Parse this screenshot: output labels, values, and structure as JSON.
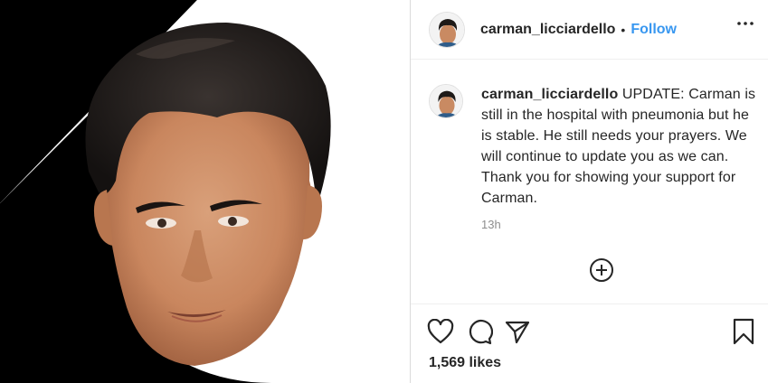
{
  "post": {
    "username": "carman_licciardello",
    "separator": "•",
    "follow_label": "Follow",
    "more_icon": "more-options-icon",
    "caption": {
      "username": "carman_licciardello",
      "text": "UPDATE: Carman is still in the hospital with pneumonia but he is stable. He still needs your prayers. We will continue to update you as we can. Thank you for showing your support for Carman.",
      "time": "13h"
    },
    "load_more_icon": "plus-circle-icon",
    "actions": {
      "like_icon": "heart-icon",
      "comment_icon": "comment-icon",
      "share_icon": "paper-plane-icon",
      "save_icon": "bookmark-icon"
    },
    "likes": "1,569 likes"
  },
  "colors": {
    "link": "#3897f0",
    "text": "#262626",
    "muted": "#8e8e8e",
    "border": "#dbdbdb"
  }
}
